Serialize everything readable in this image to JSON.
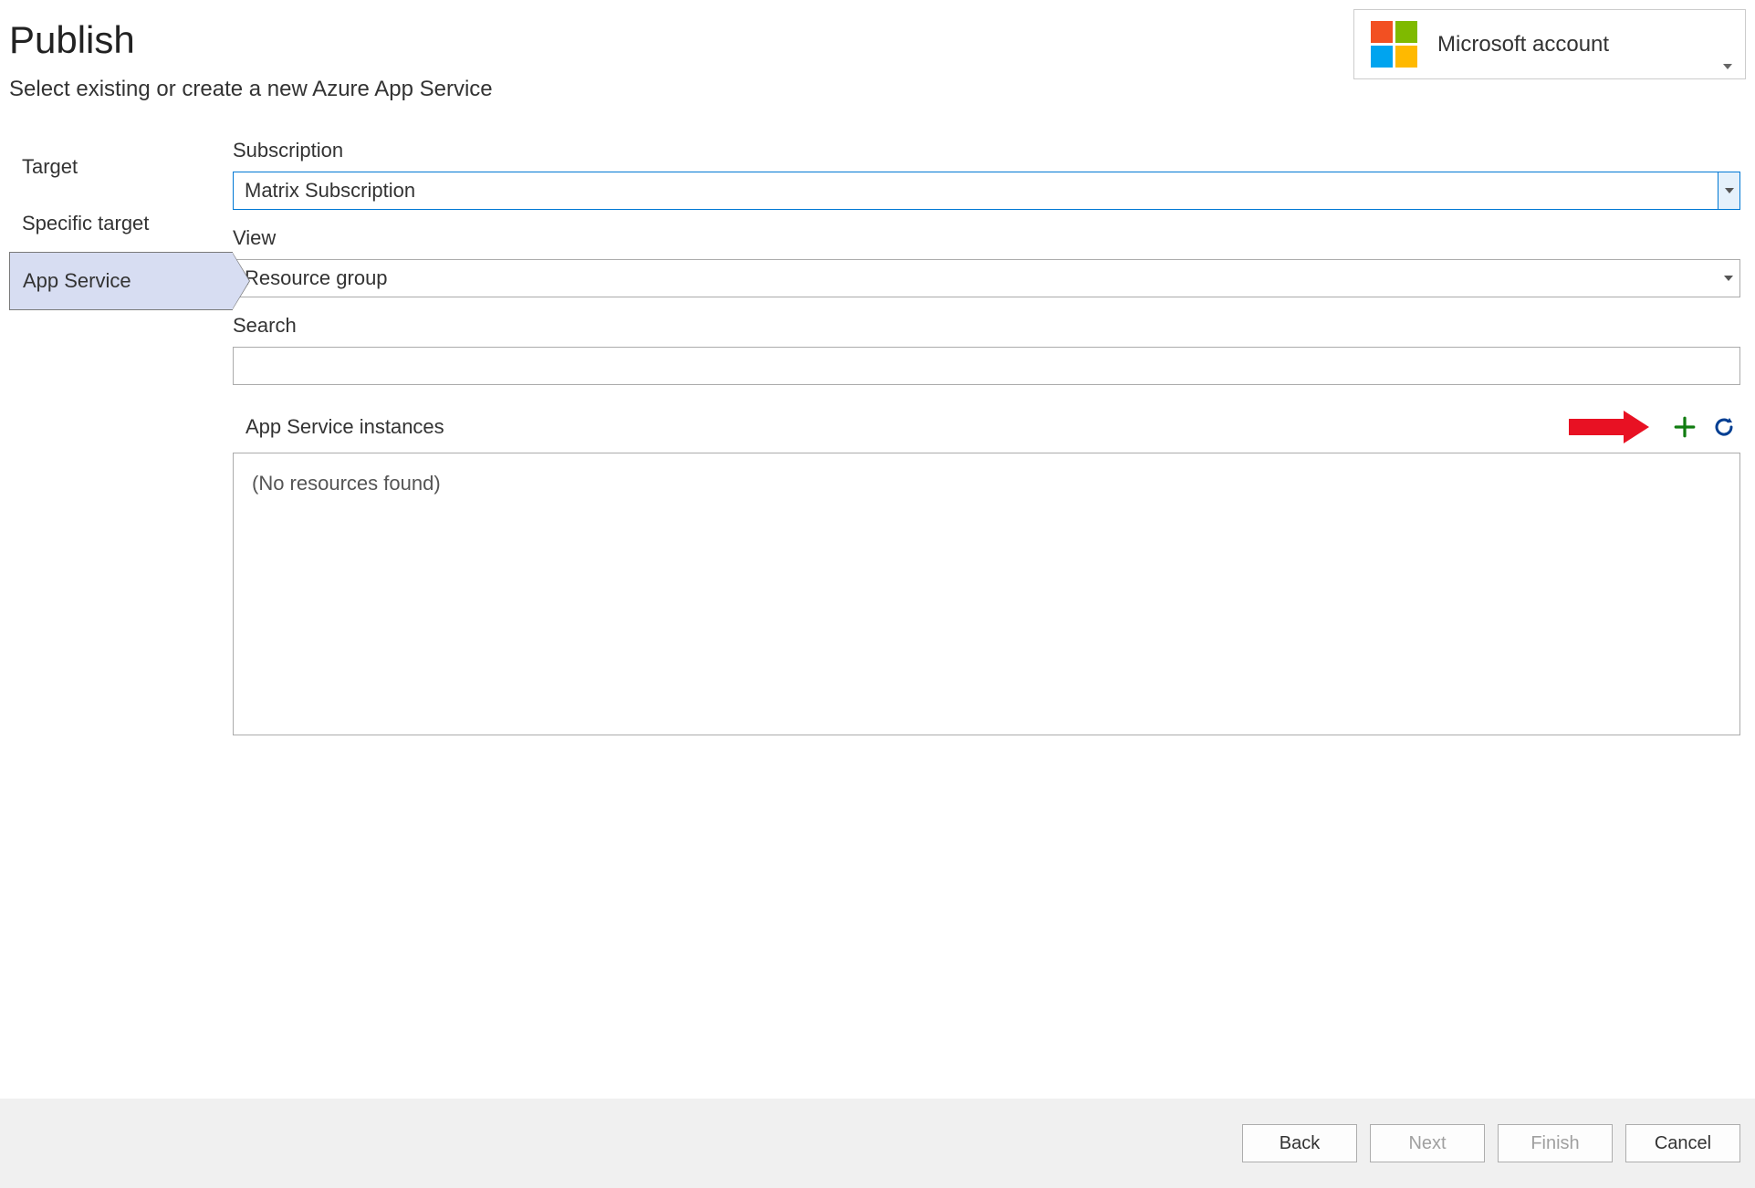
{
  "header": {
    "title": "Publish",
    "subtitle": "Select existing or create a new Azure App Service"
  },
  "account": {
    "label": "Microsoft account"
  },
  "sidebar": {
    "items": [
      {
        "label": "Target",
        "selected": false
      },
      {
        "label": "Specific target",
        "selected": false
      },
      {
        "label": "App Service",
        "selected": true
      }
    ]
  },
  "form": {
    "subscription": {
      "label": "Subscription",
      "value": "Matrix Subscription"
    },
    "view": {
      "label": "View",
      "value": "Resource group"
    },
    "search": {
      "label": "Search",
      "value": ""
    },
    "instances": {
      "label": "App Service instances",
      "empty_text": "(No resources found)"
    }
  },
  "footer": {
    "back": "Back",
    "next": "Next",
    "finish": "Finish",
    "cancel": "Cancel"
  }
}
